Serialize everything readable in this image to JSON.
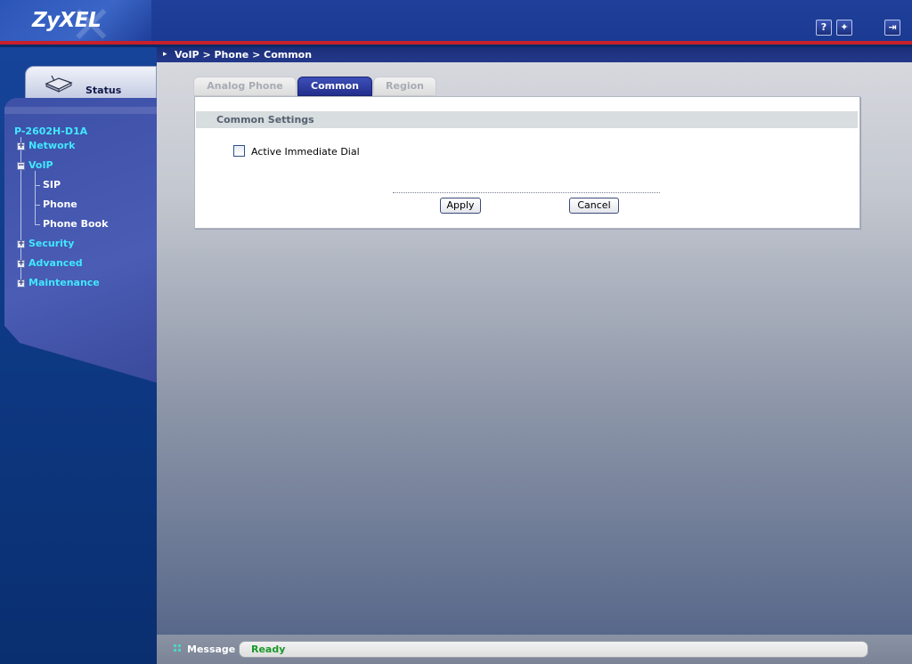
{
  "header": {
    "logo": "ZyXEL",
    "help_icon": "help-icon",
    "wizard_icon": "wizard-icon",
    "logout_icon": "logout-icon",
    "help_glyph": "?",
    "wizard_glyph": "✦",
    "logout_glyph": "⇥"
  },
  "sidebar": {
    "status_tab_label": "Status",
    "device_name": "P-2602H-D1A",
    "items": [
      {
        "label": "Network",
        "expanded": false
      },
      {
        "label": "VoIP",
        "expanded": true,
        "children": [
          "SIP",
          "Phone",
          "Phone Book"
        ]
      },
      {
        "label": "Security",
        "expanded": false
      },
      {
        "label": "Advanced",
        "expanded": false
      },
      {
        "label": "Maintenance",
        "expanded": false
      }
    ],
    "plus_glyph": "+",
    "minus_glyph": "−"
  },
  "breadcrumb": "VoIP > Phone > Common",
  "tabs": [
    {
      "label": "Analog Phone",
      "active": false
    },
    {
      "label": "Common",
      "active": true
    },
    {
      "label": "Region",
      "active": false
    }
  ],
  "section": {
    "title": "Common Settings",
    "checkbox_label": "Active Immediate Dial",
    "checked": false
  },
  "buttons": {
    "apply": "Apply",
    "cancel": "Cancel"
  },
  "statusbar": {
    "label": "Message",
    "value": "Ready"
  },
  "colors": {
    "header_blue": "#1f3f9a",
    "accent_red": "#c8202a",
    "nav_cyan": "#40e8ff",
    "ready_green": "#1a9a2a"
  }
}
